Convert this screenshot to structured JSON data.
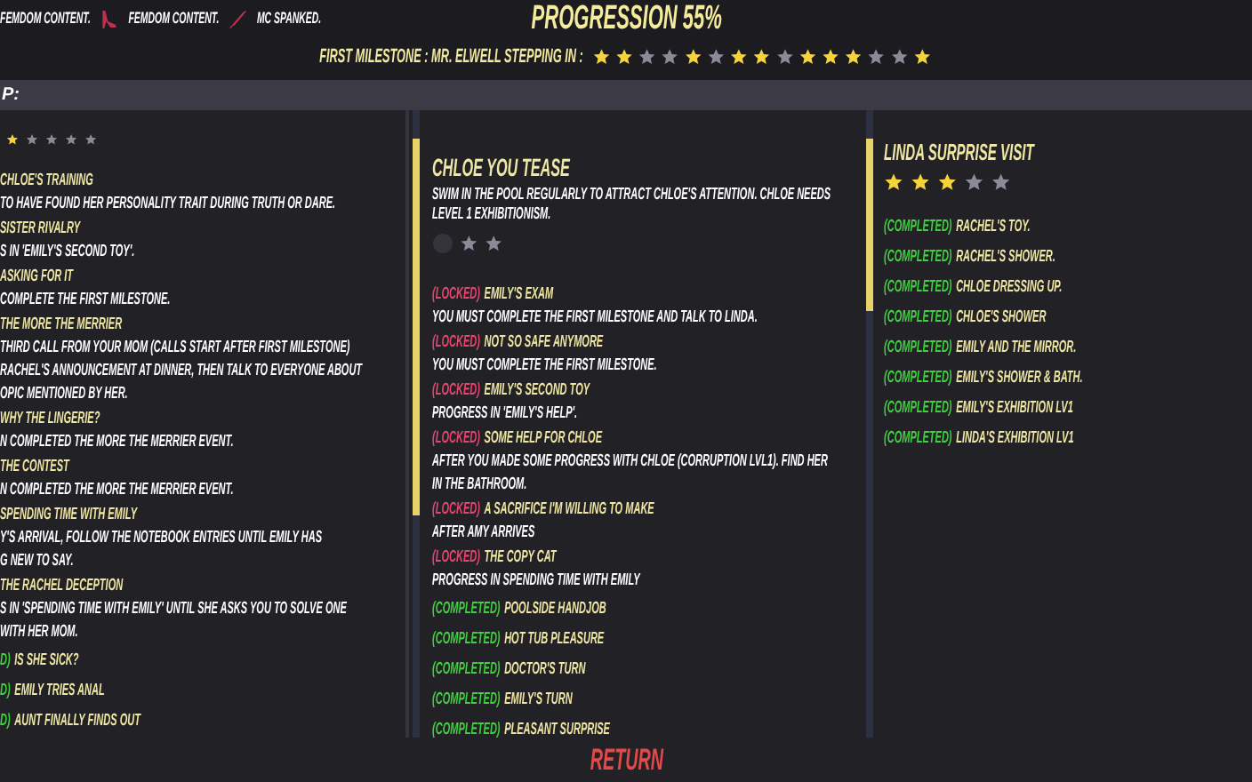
{
  "header": {
    "tags": [
      {
        "label": "FEMDOM CONTENT."
      },
      {
        "kind": "heel",
        "label": "FEMDOM CONTENT."
      },
      {
        "kind": "whip",
        "label": "MC SPANKED."
      }
    ],
    "progression": "PROGRESSION 55%",
    "milestone": {
      "label": "FIRST MILESTONE : MR. ELWELL STEPPING IN :",
      "stars": [
        {
          "filled": true
        },
        {
          "filled": true
        },
        {
          "filled": false
        },
        {
          "filled": false
        },
        {
          "filled": true
        },
        {
          "filled": false
        },
        {
          "filled": true
        },
        {
          "filled": true
        },
        {
          "filled": false
        },
        {
          "filled": true
        },
        {
          "filled": true
        },
        {
          "filled": true
        },
        {
          "filled": false
        },
        {
          "filled": false
        },
        {
          "filled": true
        }
      ]
    }
  },
  "strip_label": "P:",
  "left_column": {
    "star_row": [
      {
        "filled": true
      },
      {
        "filled": false
      },
      {
        "filled": false
      },
      {
        "filled": false
      },
      {
        "filled": false
      }
    ],
    "entries": [
      {
        "title": "CHLOE'S TRAINING",
        "description_lines": [
          "TO HAVE FOUND HER PERSONALITY TRAIT DURING TRUTH OR DARE."
        ]
      },
      {
        "title": "SISTER RIVALRY",
        "description_lines": [
          "S IN 'EMILY'S SECOND TOY'."
        ]
      },
      {
        "title": "ASKING FOR IT",
        "description_lines": [
          "COMPLETE THE FIRST MILESTONE."
        ]
      },
      {
        "title": "THE MORE THE MERRIER",
        "description_lines": [
          "THIRD CALL FROM YOUR MOM (CALLS START AFTER FIRST MILESTONE)",
          "RACHEL'S ANNOUNCEMENT AT DINNER, THEN TALK TO EVERYONE ABOUT",
          "OPIC MENTIONED BY HER."
        ]
      },
      {
        "title": "WHY THE LINGERIE?",
        "description_lines": [
          "N COMPLETED THE MORE THE MERRIER EVENT."
        ]
      },
      {
        "title": "THE CONTEST",
        "description_lines": [
          "N COMPLETED THE MORE THE MERRIER EVENT."
        ]
      },
      {
        "title": "SPENDING TIME WITH EMILY",
        "description_lines": [
          "Y'S ARRIVAL, FOLLOW THE NOTEBOOK ENTRIES UNTIL EMILY HAS",
          "G NEW TO SAY."
        ]
      },
      {
        "title": "THE RACHEL DECEPTION",
        "description_lines": [
          "S IN 'SPENDING TIME WITH EMILY' UNTIL SHE ASKS YOU TO SOLVE ONE",
          "WITH HER MOM."
        ]
      },
      {
        "color": "#3fd13f",
        "tag": "D)",
        "title": "IS SHE SICK?"
      },
      {
        "color": "#3fd13f",
        "tag": "D)",
        "title": "EMILY TRIES ANAL"
      },
      {
        "color": "#3fd13f",
        "tag": "D)",
        "title": "AUNT FINALLY FINDS OUT"
      }
    ]
  },
  "middle_column": {
    "title": "CHLOE YOU TEASE",
    "description": "SWIM IN THE POOL REGULARLY TO ATTRACT CHLOE'S ATTENTION. CHLOE NEEDS LEVEL 1 EXHIBITIONISM.",
    "star_row": [
      {
        "filled": false
      },
      {
        "filled": false
      }
    ],
    "entries": [
      {
        "color": "#e4466f",
        "tag": "(LOCKED)",
        "title": "EMILY'S EXAM",
        "description": "YOU MUST COMPLETE THE FIRST MILESTONE AND TALK TO LINDA."
      },
      {
        "color": "#e4466f",
        "tag": "(LOCKED)",
        "title": "NOT SO SAFE ANYMORE",
        "description": "YOU MUST COMPLETE THE FIRST MILESTONE."
      },
      {
        "color": "#e4466f",
        "tag": "(LOCKED)",
        "title": "EMILY'S SECOND TOY",
        "description": "PROGRESS IN 'EMILY'S HELP'."
      },
      {
        "color": "#e4466f",
        "tag": "(LOCKED)",
        "title": "SOME HELP FOR CHLOE",
        "description": "AFTER YOU MADE SOME PROGRESS WITH CHLOE (CORRUPTION LVL1). FIND HER IN THE BATHROOM."
      },
      {
        "color": "#e4466f",
        "tag": "(LOCKED)",
        "title": "A SACRIFICE I'M WILLING TO MAKE",
        "description": "AFTER AMY ARRIVES"
      },
      {
        "color": "#e4466f",
        "tag": "(LOCKED)",
        "title": "THE COPY CAT",
        "description": "PROGRESS IN SPENDING TIME WITH EMILY"
      },
      {
        "color": "#3fd13f",
        "tag": "(COMPLETED)",
        "title": "POOLSIDE HANDJOB"
      },
      {
        "color": "#3fd13f",
        "tag": "(COMPLETED)",
        "title": "HOT TUB PLEASURE"
      },
      {
        "color": "#3fd13f",
        "tag": "(COMPLETED)",
        "title": "DOCTOR'S TURN"
      },
      {
        "color": "#3fd13f",
        "tag": "(COMPLETED)",
        "title": "EMILY'S TURN"
      },
      {
        "color": "#3fd13f",
        "tag": "(COMPLETED)",
        "title": "PLEASANT SURPRISE"
      }
    ]
  },
  "right_column": {
    "title": "LINDA SURPRISE VISIT",
    "star_row": [
      {
        "filled": true
      },
      {
        "filled": true
      },
      {
        "filled": true
      },
      {
        "filled": false
      },
      {
        "filled": false
      }
    ],
    "entries": [
      {
        "color": "#3fd13f",
        "tag": "(COMPLETED)",
        "title": "RACHEL'S TOY."
      },
      {
        "color": "#3fd13f",
        "tag": "(COMPLETED)",
        "title": "RACHEL'S SHOWER."
      },
      {
        "color": "#3fd13f",
        "tag": "(COMPLETED)",
        "title": "CHLOE DRESSING UP."
      },
      {
        "color": "#3fd13f",
        "tag": "(COMPLETED)",
        "title": "CHLOE'S SHOWER"
      },
      {
        "color": "#3fd13f",
        "tag": "(COMPLETED)",
        "title": "EMILY AND THE MIRROR."
      },
      {
        "color": "#3fd13f",
        "tag": "(COMPLETED)",
        "title": "EMILY'S SHOWER & BATH."
      },
      {
        "color": "#3fd13f",
        "tag": "(COMPLETED)",
        "title": "EMILY'S EXHIBITION LV1"
      },
      {
        "color": "#3fd13f",
        "tag": "(COMPLETED)",
        "title": "LINDA'S EXHIBITION LV1"
      }
    ]
  },
  "return_label": "RETURN"
}
